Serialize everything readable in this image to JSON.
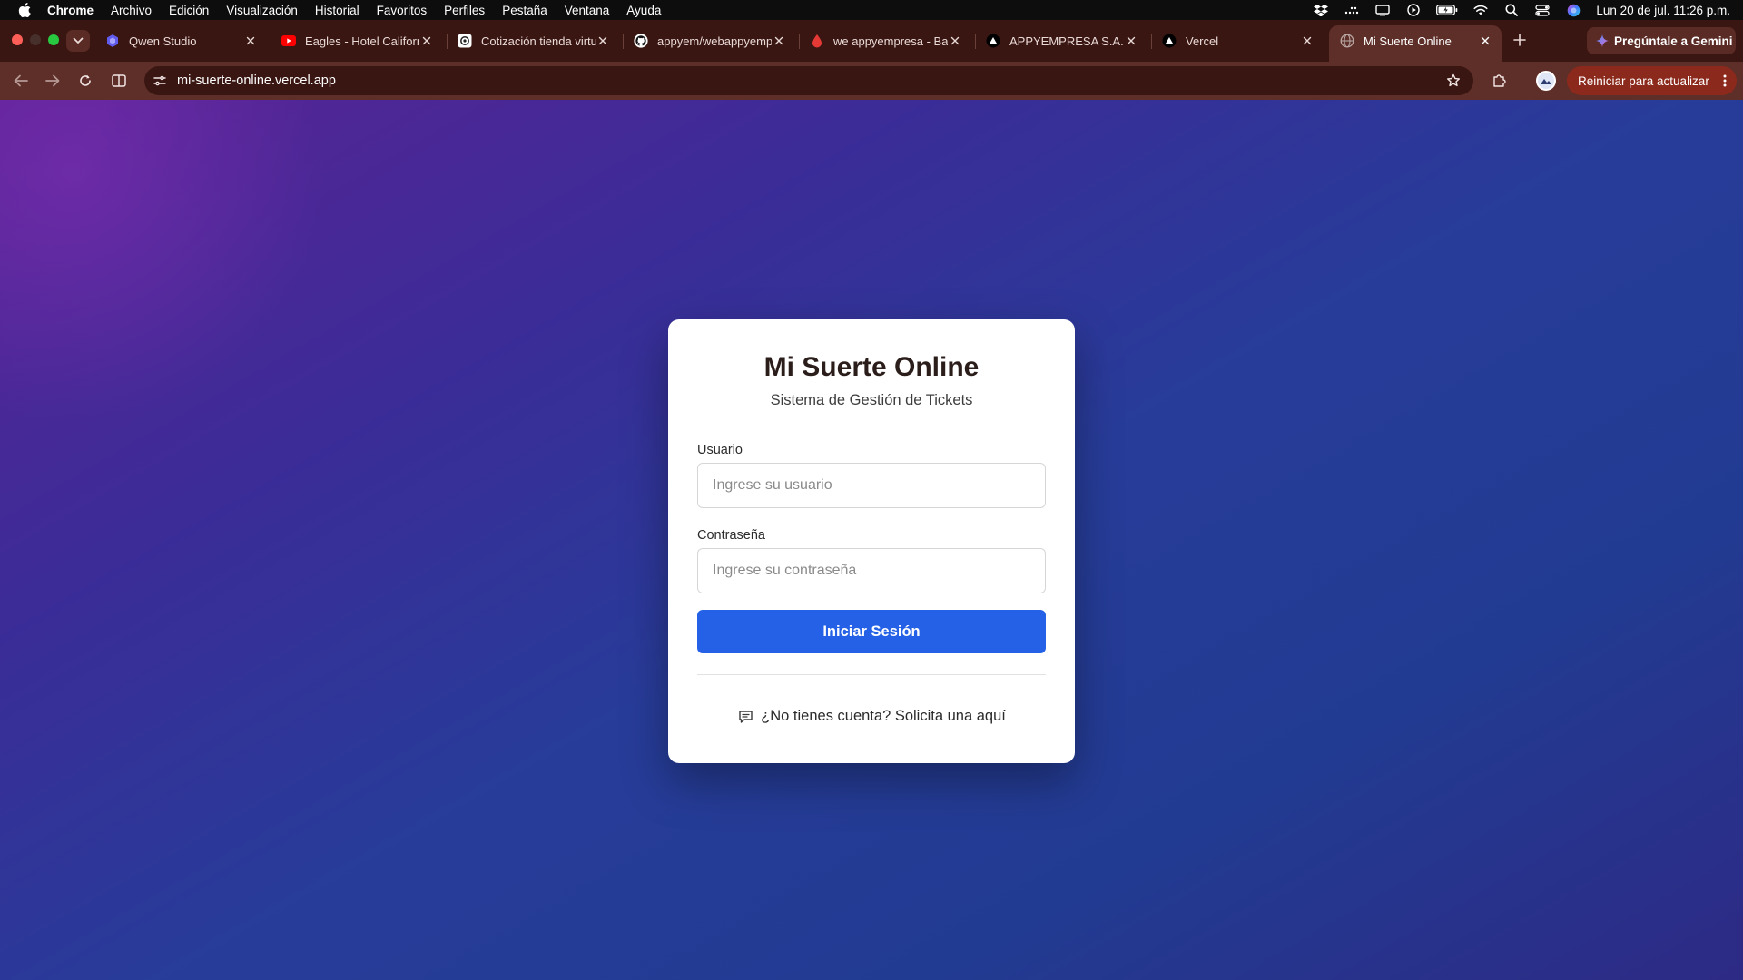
{
  "menubar": {
    "app_name": "Chrome",
    "items": [
      "Archivo",
      "Edición",
      "Visualización",
      "Historial",
      "Favoritos",
      "Perfiles",
      "Pestaña",
      "Ventana",
      "Ayuda"
    ],
    "clock": "Lun 20 de jul.  11:26 p.m.",
    "status_icons": [
      "dropbox-icon",
      "upload-dots-icon",
      "display-icon",
      "play-icon",
      "battery-icon",
      "wifi-icon",
      "search-icon",
      "control-center-icon",
      "siri-icon"
    ]
  },
  "tabs": [
    {
      "title": "Qwen Studio",
      "icon": "qwen-icon",
      "active": false
    },
    {
      "title": "Eagles - Hotel California",
      "icon": "youtube-icon",
      "active": false
    },
    {
      "title": "Cotización tienda virtual",
      "icon": "openai-icon",
      "active": false
    },
    {
      "title": "appyem/webappyempresa",
      "icon": "github-icon",
      "active": false
    },
    {
      "title": "we appyempresa - Base",
      "icon": "drop-icon",
      "active": false
    },
    {
      "title": "APPYEMPRESA S.A.S",
      "icon": "vercel-icon",
      "active": false
    },
    {
      "title": "Vercel",
      "icon": "vercel-icon",
      "active": false
    },
    {
      "title": "Mi Suerte Online",
      "icon": "globe-icon",
      "active": true
    }
  ],
  "gemini_button": "Pregúntale a Gemini",
  "toolbar": {
    "url": "mi-suerte-online.vercel.app",
    "relaunch_label": "Reiniciar para actualizar"
  },
  "colors": {
    "tab_strip": "#3a1612",
    "toolbar": "#5e2e28",
    "primary_button": "#2461e6",
    "background_start": "#5a2394",
    "background_end": "#223b92"
  },
  "login": {
    "title": "Mi Suerte Online",
    "subtitle": "Sistema de Gestión de Tickets",
    "username_label": "Usuario",
    "username_placeholder": "Ingrese su usuario",
    "password_label": "Contraseña",
    "password_placeholder": "Ingrese su contraseña",
    "submit_label": "Iniciar Sesión",
    "request_account_text": "¿No tienes cuenta? Solicita una aquí"
  }
}
